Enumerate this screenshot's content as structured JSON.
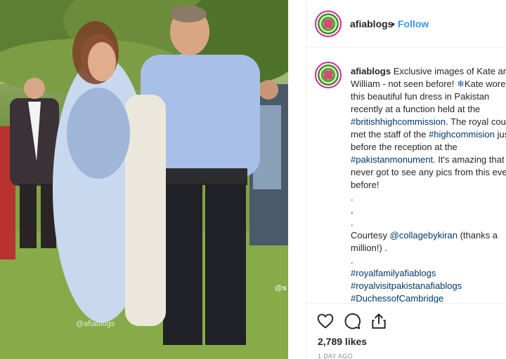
{
  "photo": {
    "alt": "",
    "watermark": "@afiablogs",
    "corner_tag": "@s"
  },
  "header": {
    "username": "afiablogs",
    "separator": "•",
    "follow_label": "Follow"
  },
  "caption": {
    "username": "afiablogs",
    "segments": [
      {
        "t": "Exclusive images of Kate and William - not seen before! ",
        "k": "text"
      },
      {
        "t": "❄",
        "k": "emoji"
      },
      {
        "t": "Kate wore this beautiful fun dress in Pakistan recently at a function held at the ",
        "k": "text"
      },
      {
        "t": "#britishhighcommission",
        "k": "tag"
      },
      {
        "t": ". The royal couple met the staff of the ",
        "k": "text"
      },
      {
        "t": "#highcommision",
        "k": "tag"
      },
      {
        "t": " just before the reception at the ",
        "k": "text"
      },
      {
        "t": "#pakistanmonument",
        "k": "tag"
      },
      {
        "t": ". It's amazing that we never got to see any pics from this event before!\n.\n,\n.\nCourtesy ",
        "k": "text"
      },
      {
        "t": "@collagebykiran",
        "k": "tag"
      },
      {
        "t": " (thanks a million!) .\n.\n",
        "k": "text"
      },
      {
        "t": "#royalfamilyafiablogs",
        "k": "tag"
      },
      {
        "t": "\n",
        "k": "text"
      },
      {
        "t": "#royalvisitpakistanafiablogs",
        "k": "tag"
      },
      {
        "t": "\n",
        "k": "text"
      },
      {
        "t": "#DuchessofCambridge",
        "k": "tag"
      }
    ]
  },
  "actions": {
    "like_icon": "heart-icon",
    "comment_icon": "comment-icon",
    "share_icon": "share-icon"
  },
  "likes": "2,789 likes",
  "timestamp": "1 DAY AGO"
}
